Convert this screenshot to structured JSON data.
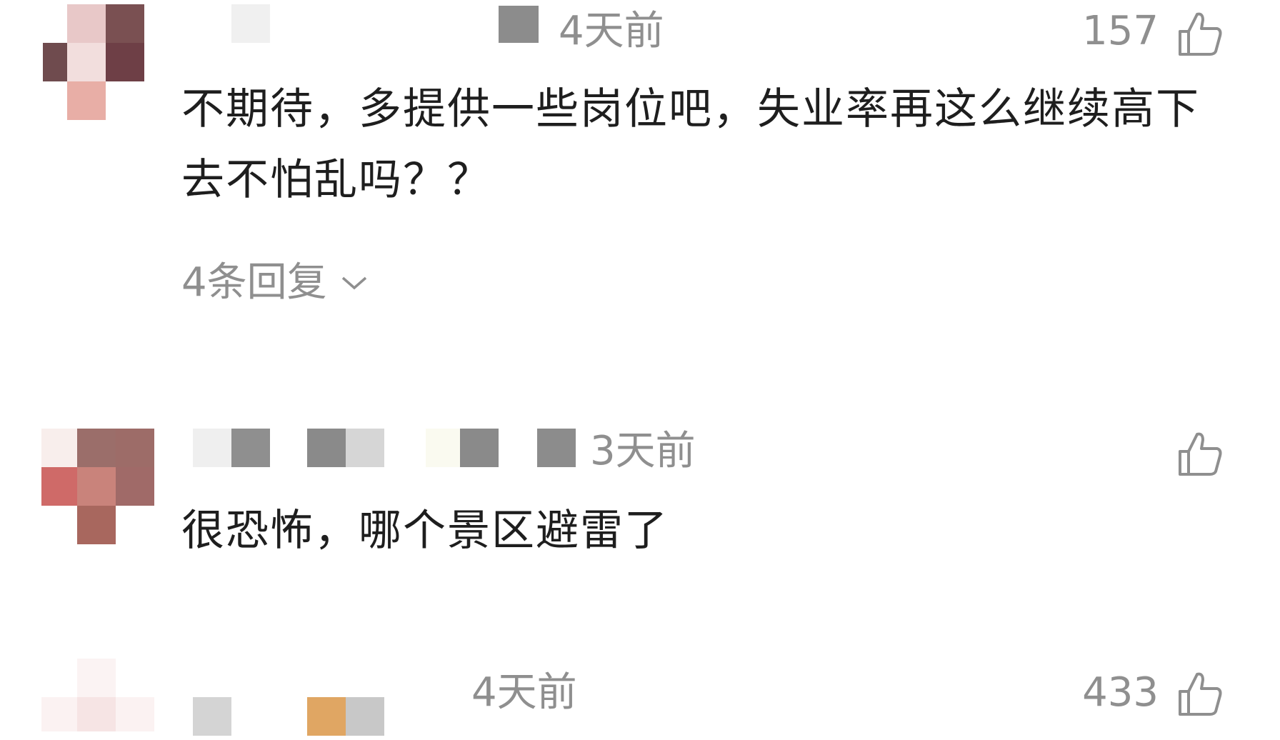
{
  "comments": [
    {
      "time": "4天前",
      "likes": "157",
      "text": "不期待，多提供一些岗位吧，失业率再这么继续高下去不怕乱吗？？",
      "replies_label": "4条回复",
      "like_icon": "thumbs-up-icon",
      "expand_icon": "chevron-down-icon"
    },
    {
      "time": "3天前",
      "likes": "",
      "text": "很恐怖，哪个景区避雷了",
      "like_icon": "thumbs-up-icon"
    },
    {
      "time": "4天前",
      "likes": "433",
      "like_icon": "thumbs-up-icon"
    }
  ],
  "colors": {
    "meta_gray": "#8f8f8f",
    "body_text": "#1e1e1e",
    "background": "#ffffff"
  }
}
